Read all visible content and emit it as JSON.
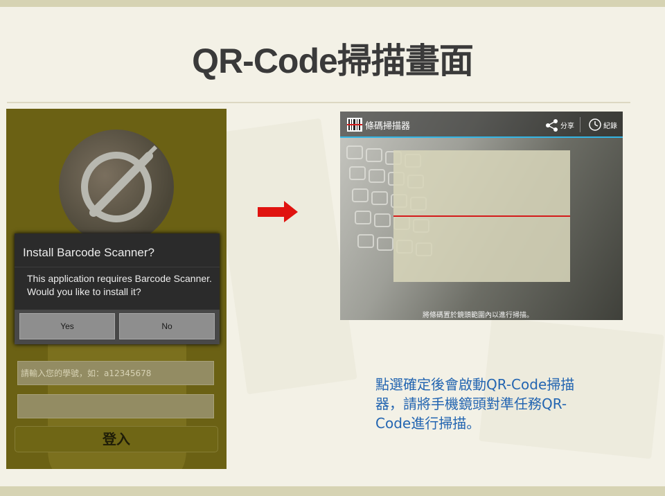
{
  "slide": {
    "title": "QR-Code掃描畫面",
    "caption": "點選確定後會啟動QR-Code掃描器，請將手機鏡頭對準任務QR-Code進行掃描。",
    "colors": {
      "caption": "#2365b1",
      "arrow": "#e0130f",
      "accent_line": "#33b5e5",
      "laser": "#d41a1a"
    }
  },
  "left_phone": {
    "dialog": {
      "title": "Install Barcode Scanner?",
      "message": "This application requires Barcode Scanner. Would you like to install it?",
      "yes_label": "Yes",
      "no_label": "No"
    },
    "student_id_placeholder": "請輸入您的學號，如：a12345678",
    "password_value": "",
    "login_label": "登入",
    "avatar_icon": "compass-icon"
  },
  "right_phone": {
    "app_title": "條碼掃描器",
    "share_label": "分享",
    "history_label": "紀錄",
    "hint": "將條碼置於鏡頭範圍內以進行掃描。",
    "icons": [
      "barcode-icon",
      "share-icon",
      "clock-icon"
    ]
  }
}
